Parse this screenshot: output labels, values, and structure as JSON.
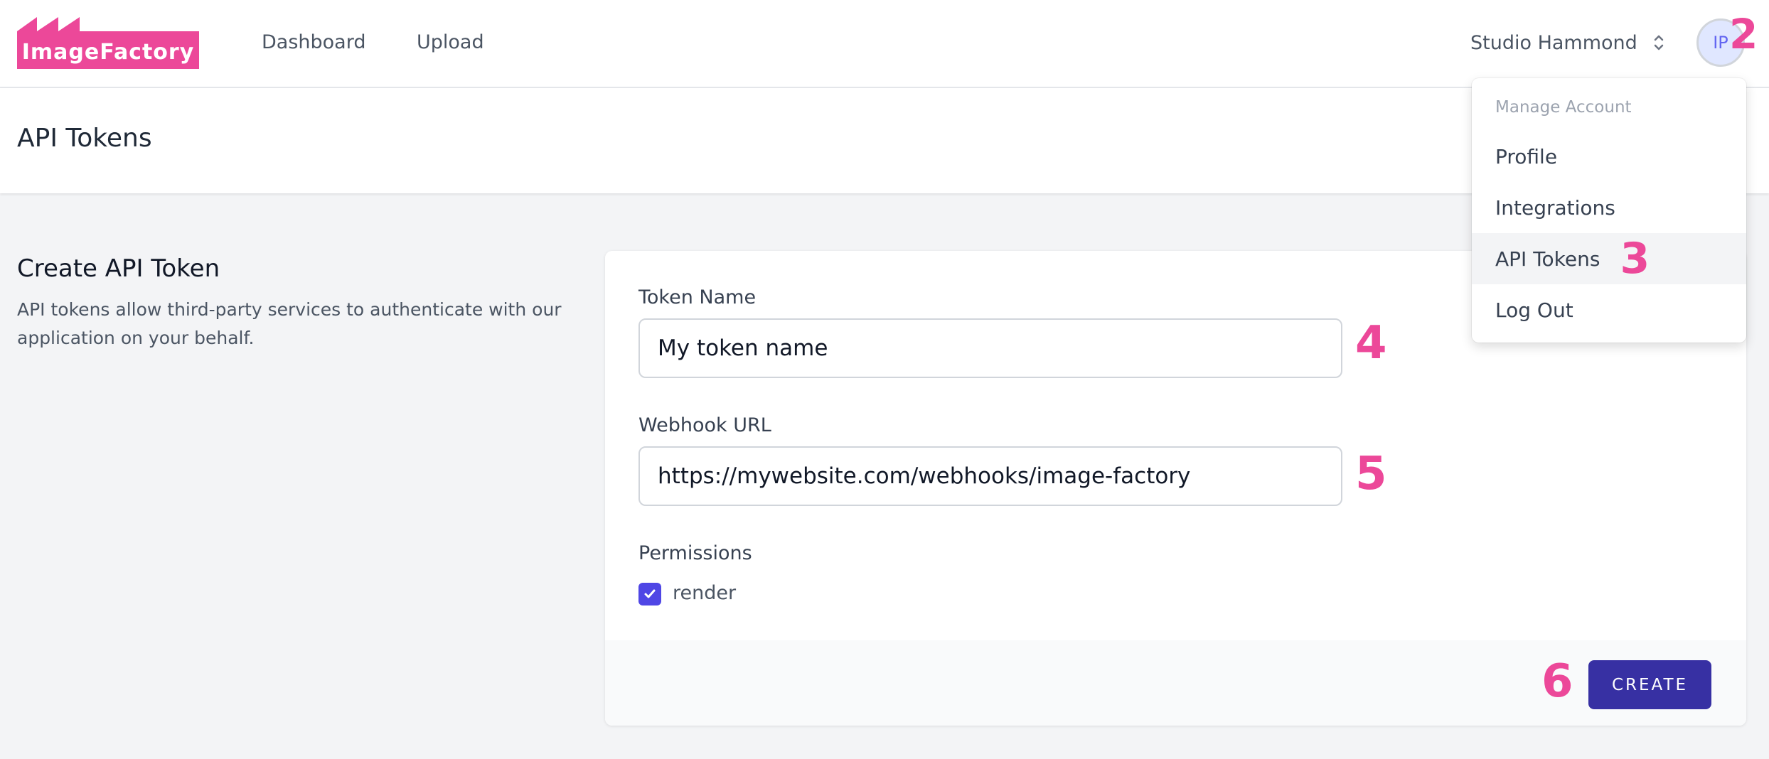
{
  "app": {
    "logo_text": "ImageFactory",
    "brand_color": "#ec4899",
    "accent_color": "#3730a3"
  },
  "nav": {
    "links": [
      {
        "label": "Dashboard"
      },
      {
        "label": "Upload"
      }
    ],
    "team": "Studio Hammond",
    "team_switch_icon": "chevron-up-down-icon",
    "avatar_initials": "IP"
  },
  "page": {
    "title": "API Tokens"
  },
  "section": {
    "title": "Create API Token",
    "description": "API tokens allow third-party services to authenticate with our application on your behalf."
  },
  "form": {
    "token_name": {
      "label": "Token Name",
      "value": "My token name"
    },
    "webhook_url": {
      "label": "Webhook URL",
      "value": "https://mywebsite.com/webhooks/image-factory"
    },
    "permissions": {
      "label": "Permissions",
      "options": [
        {
          "label": "render",
          "checked": true
        }
      ]
    },
    "submit_label": "CREATE"
  },
  "dropdown": {
    "header": "Manage Account",
    "items": [
      {
        "label": "Profile",
        "active": false
      },
      {
        "label": "Integrations",
        "active": false
      },
      {
        "label": "API Tokens",
        "active": true
      },
      {
        "label": "Log Out",
        "active": false
      }
    ]
  },
  "annotations": {
    "avatar": "2",
    "api_tokens_item": "3",
    "token_name": "4",
    "webhook_url": "5",
    "create": "6"
  }
}
